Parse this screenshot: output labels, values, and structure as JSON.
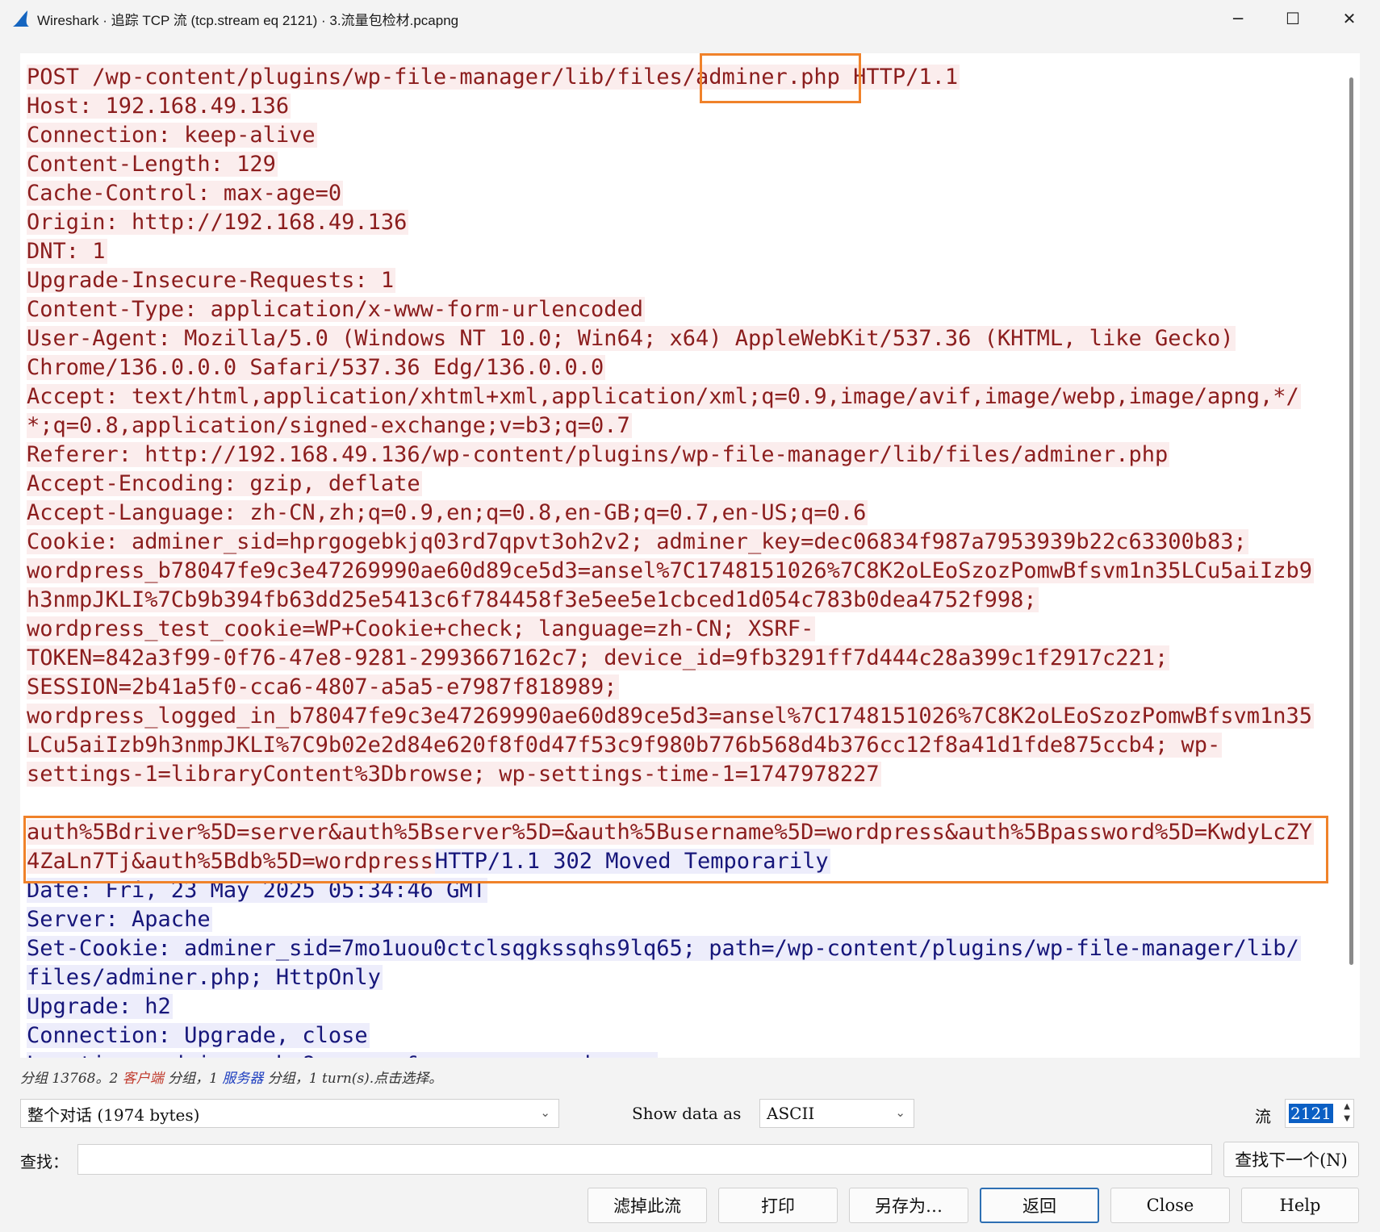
{
  "window": {
    "title": "Wireshark · 追踪 TCP 流 (tcp.stream eq 2121) · 3.流量包检材.pcapng",
    "icon": "wireshark-fin-icon",
    "minimize": "─",
    "maximize": "☐",
    "close": "✕"
  },
  "stream": {
    "client_color": "#8b1d1d",
    "server_color": "#16167a",
    "client_lines": [
      "POST /wp-content/plugins/wp-file-manager/lib/files/adminer.php HTTP/1.1",
      "Host: 192.168.49.136",
      "Connection: keep-alive",
      "Content-Length: 129",
      "Cache-Control: max-age=0",
      "Origin: http://192.168.49.136",
      "DNT: 1",
      "Upgrade-Insecure-Requests: 1",
      "Content-Type: application/x-www-form-urlencoded",
      "User-Agent: Mozilla/5.0 (Windows NT 10.0; Win64; x64) AppleWebKit/537.36 (KHTML, like Gecko)",
      "Chrome/136.0.0.0 Safari/537.36 Edg/136.0.0.0",
      "Accept: text/html,application/xhtml+xml,application/xml;q=0.9,image/avif,image/webp,image/apng,*/",
      "*;q=0.8,application/signed-exchange;v=b3;q=0.7",
      "Referer: http://192.168.49.136/wp-content/plugins/wp-file-manager/lib/files/adminer.php",
      "Accept-Encoding: gzip, deflate",
      "Accept-Language: zh-CN,zh;q=0.9,en;q=0.8,en-GB;q=0.7,en-US;q=0.6",
      "Cookie: adminer_sid=hprgogebkjq03rd7qpvt3oh2v2; adminer_key=dec06834f987a7953939b22c63300b83;",
      "wordpress_b78047fe9c3e47269990ae60d89ce5d3=ansel%7C1748151026%7C8K2oLEoSzozPomwBfsvm1n35LCu5aiIzb9",
      "h3nmpJKLI%7Cb9b394fb63dd25e5413c6f784458f3e5ee5e1cbced1d054c783b0dea4752f998;",
      "wordpress_test_cookie=WP+Cookie+check; language=zh-CN; XSRF-",
      "TOKEN=842a3f99-0f76-47e8-9281-2993667162c7; device_id=9fb3291ff7d444c28a399c1f2917c221;",
      "SESSION=2b41a5f0-cca6-4807-a5a5-e7987f818989;",
      "wordpress_logged_in_b78047fe9c3e47269990ae60d89ce5d3=ansel%7C1748151026%7C8K2oLEoSzozPomwBfsvm1n35",
      "LCu5aiIzb9h3nmpJKLI%7C9b02e2d84e620f8f0d47f53c9f980b776b568d4b376cc12f8a41d1fde875ccb4; wp-",
      "settings-1=libraryContent%3Dbrowse; wp-settings-time-1=1747978227"
    ],
    "body_line1": "auth%5Bdriver%5D=server&auth%5Bserver%5D=&auth%5Busername%5D=wordpress&auth%5Bpassword%5D=KwdyLcZY",
    "body_line2_client": "4ZaLn7Tj&auth%5Bdb%5D=wordpress",
    "body_line2_server": "HTTP/1.1 302 Moved Temporarily",
    "server_lines": [
      "Date: Fri, 23 May 2025 05:34:46 GMT",
      "Server: Apache",
      "Set-Cookie: adminer_sid=7mo1uou0ctclsqgkssqhs9lq65; path=/wp-content/plugins/wp-file-manager/lib/",
      "files/adminer.php; HttpOnly",
      "Upgrade: h2",
      "Connection: Upgrade, close",
      "Location: adminer.php?server=&username=wordpress"
    ]
  },
  "status": {
    "prefix": "分组 13768。2 ",
    "client": "客户端",
    "mid": " 分组，1 ",
    "server": "服务器",
    "suffix": " 分组，1 turn(s).点击选择。"
  },
  "controls": {
    "conversation": "整个对话 (1974 bytes)",
    "show_data_as_label": "Show data as",
    "show_data_as_value": "ASCII",
    "stream_label": "流",
    "stream_value": "2121",
    "find_label": "查找：",
    "find_value": "",
    "find_next": "查找下一个(N)",
    "filter_out": "滤掉此流",
    "print": "打印",
    "save_as": "另存为…",
    "back": "返回",
    "close": "Close",
    "help": "Help",
    "dropdown_icon": "chevron-down-icon"
  },
  "highlight_color": "#f0822a"
}
